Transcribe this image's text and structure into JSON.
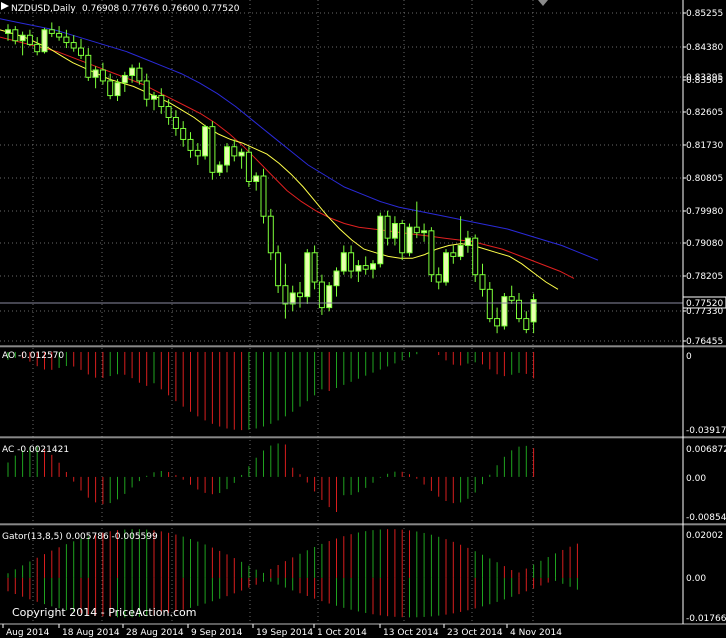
{
  "chart_data": {
    "type": "candlestick",
    "symbol_header": "NZDUSD,Daily",
    "ohlc_header": "0.76908 0.77676 0.76600 0.77520",
    "current_price_label": "0.77520",
    "copyright": "Copyright 2014 - PriceAction.com",
    "colors": {
      "background": "#000000",
      "grid": "#6a6a6a",
      "bull_candle": "#e8ffb0",
      "bear_candle": "#000000",
      "candle_outline": "#7dff3a",
      "lips": "#ffff4a",
      "teeth": "#e02020",
      "jaw": "#2a2ad8",
      "hist_up": "#1fa31f",
      "hist_down": "#d81e1e",
      "price_line": "#8a8aa0"
    },
    "price_axis": {
      "min": 0.7625,
      "max": 0.8555,
      "ticks": [
        "0.85255",
        "0.84380",
        "0.83395",
        "0.83505",
        "0.82605",
        "0.81730",
        "0.80805",
        "0.79980",
        "0.79080",
        "0.78205",
        "0.77330",
        "0.76455"
      ]
    },
    "date_axis": [
      "Aug 2014",
      "18 Aug 2014",
      "28 Aug 2014",
      "9 Sep 2014",
      "19 Sep 2014",
      "1 Oct 2014",
      "13 Oct 2014",
      "23 Oct 2014",
      "4 Nov 2014"
    ],
    "candles": [
      [
        0.848,
        0.8505,
        0.846,
        0.849
      ],
      [
        0.849,
        0.85,
        0.845,
        0.846
      ],
      [
        0.846,
        0.8485,
        0.842,
        0.8475
      ],
      [
        0.8475,
        0.849,
        0.8445,
        0.845
      ],
      [
        0.845,
        0.847,
        0.842,
        0.843
      ],
      [
        0.843,
        0.8495,
        0.8425,
        0.849
      ],
      [
        0.849,
        0.851,
        0.847,
        0.848
      ],
      [
        0.848,
        0.85,
        0.846,
        0.847
      ],
      [
        0.847,
        0.849,
        0.844,
        0.8455
      ],
      [
        0.8455,
        0.8475,
        0.843,
        0.844
      ],
      [
        0.844,
        0.8465,
        0.841,
        0.842
      ],
      [
        0.842,
        0.844,
        0.835,
        0.836
      ],
      [
        0.836,
        0.839,
        0.833,
        0.838
      ],
      [
        0.838,
        0.84,
        0.834,
        0.835
      ],
      [
        0.835,
        0.837,
        0.83,
        0.831
      ],
      [
        0.831,
        0.8355,
        0.8295,
        0.8345
      ],
      [
        0.8345,
        0.8375,
        0.832,
        0.8365
      ],
      [
        0.8365,
        0.8395,
        0.8345,
        0.8385
      ],
      [
        0.8385,
        0.84,
        0.834,
        0.835
      ],
      [
        0.835,
        0.837,
        0.828,
        0.83
      ],
      [
        0.83,
        0.832,
        0.827,
        0.831
      ],
      [
        0.831,
        0.833,
        0.826,
        0.828
      ],
      [
        0.828,
        0.83,
        0.823,
        0.825
      ],
      [
        0.825,
        0.827,
        0.82,
        0.822
      ],
      [
        0.822,
        0.824,
        0.817,
        0.819
      ],
      [
        0.819,
        0.821,
        0.814,
        0.816
      ],
      [
        0.816,
        0.818,
        0.812,
        0.8145
      ],
      [
        0.8145,
        0.823,
        0.8135,
        0.8225
      ],
      [
        0.8225,
        0.824,
        0.808,
        0.81
      ],
      [
        0.81,
        0.813,
        0.809,
        0.812
      ],
      [
        0.812,
        0.818,
        0.81,
        0.817
      ],
      [
        0.817,
        0.819,
        0.813,
        0.8145
      ],
      [
        0.8145,
        0.8165,
        0.811,
        0.8155
      ],
      [
        0.8155,
        0.817,
        0.806,
        0.8075
      ],
      [
        0.8075,
        0.81,
        0.805,
        0.809
      ],
      [
        0.809,
        0.811,
        0.796,
        0.798
      ],
      [
        0.798,
        0.8,
        0.786,
        0.788
      ],
      [
        0.788,
        0.79,
        0.777,
        0.779
      ],
      [
        0.779,
        0.785,
        0.77,
        0.774
      ],
      [
        0.774,
        0.779,
        0.772,
        0.777
      ],
      [
        0.777,
        0.78,
        0.773,
        0.776
      ],
      [
        0.776,
        0.789,
        0.774,
        0.788
      ],
      [
        0.788,
        0.79,
        0.778,
        0.78
      ],
      [
        0.78,
        0.782,
        0.771,
        0.773
      ],
      [
        0.773,
        0.78,
        0.772,
        0.779
      ],
      [
        0.779,
        0.784,
        0.776,
        0.783
      ],
      [
        0.783,
        0.79,
        0.782,
        0.788
      ],
      [
        0.788,
        0.79,
        0.781,
        0.783
      ],
      [
        0.783,
        0.786,
        0.78,
        0.7845
      ],
      [
        0.7845,
        0.787,
        0.782,
        0.7835
      ],
      [
        0.7835,
        0.786,
        0.781,
        0.785
      ],
      [
        0.785,
        0.799,
        0.784,
        0.798
      ],
      [
        0.798,
        0.7995,
        0.79,
        0.792
      ],
      [
        0.792,
        0.798,
        0.79,
        0.796
      ],
      [
        0.796,
        0.797,
        0.786,
        0.788
      ],
      [
        0.788,
        0.796,
        0.787,
        0.795
      ],
      [
        0.795,
        0.802,
        0.792,
        0.7935
      ],
      [
        0.7935,
        0.796,
        0.791,
        0.794
      ],
      [
        0.794,
        0.795,
        0.78,
        0.782
      ],
      [
        0.782,
        0.784,
        0.778,
        0.78
      ],
      [
        0.78,
        0.789,
        0.779,
        0.788
      ],
      [
        0.788,
        0.79,
        0.785,
        0.787
      ],
      [
        0.787,
        0.798,
        0.786,
        0.79
      ],
      [
        0.79,
        0.794,
        0.788,
        0.792
      ],
      [
        0.792,
        0.793,
        0.78,
        0.782
      ],
      [
        0.782,
        0.785,
        0.776,
        0.778
      ],
      [
        0.778,
        0.78,
        0.769,
        0.77
      ],
      [
        0.77,
        0.773,
        0.766,
        0.768
      ],
      [
        0.768,
        0.777,
        0.767,
        0.776
      ],
      [
        0.776,
        0.779,
        0.774,
        0.775
      ],
      [
        0.775,
        0.777,
        0.769,
        0.77
      ],
      [
        0.77,
        0.772,
        0.766,
        0.767
      ],
      [
        0.7691,
        0.7768,
        0.766,
        0.7752
      ]
    ],
    "alligator": {
      "lips": [
        0.849,
        0.848,
        0.847,
        0.8455,
        0.844,
        0.842,
        0.84,
        0.8385,
        0.837,
        0.8355,
        0.8345,
        0.8335,
        0.832,
        0.8305,
        0.829,
        0.827,
        0.825,
        0.8225,
        0.8205,
        0.819,
        0.818,
        0.8165,
        0.815,
        0.8125,
        0.8095,
        0.806,
        0.802,
        0.798,
        0.7945,
        0.7915,
        0.789,
        0.788,
        0.787,
        0.7865,
        0.7865,
        0.7875,
        0.789,
        0.79,
        0.7905,
        0.79,
        0.789,
        0.788,
        0.787,
        0.785,
        0.7825,
        0.78,
        0.778
      ],
      "lips_start": 26,
      "teeth": [
        0.847,
        0.846,
        0.845,
        0.844,
        0.843,
        0.8415,
        0.84,
        0.8385,
        0.837,
        0.8355,
        0.834,
        0.832,
        0.83,
        0.828,
        0.826,
        0.8235,
        0.8205,
        0.817,
        0.813,
        0.809,
        0.805,
        0.802,
        0.7995,
        0.7975,
        0.796,
        0.795,
        0.7945,
        0.794,
        0.7935,
        0.793,
        0.7925,
        0.792,
        0.7915,
        0.791,
        0.79,
        0.789,
        0.7875,
        0.786,
        0.7845,
        0.783,
        0.781
      ],
      "teeth_start": 34,
      "jaw": [
        0.852,
        0.851,
        0.85,
        0.849,
        0.8475,
        0.846,
        0.8445,
        0.843,
        0.841,
        0.839,
        0.837,
        0.8345,
        0.8315,
        0.828,
        0.824,
        0.82,
        0.816,
        0.812,
        0.809,
        0.806,
        0.804,
        0.802,
        0.8005,
        0.7995,
        0.7985,
        0.7975,
        0.7965,
        0.7955,
        0.7945,
        0.793,
        0.7915,
        0.79,
        0.788,
        0.786
      ],
      "jaw_start": 46
    },
    "ao": {
      "label": "AO -0.012570",
      "scale_top": "0",
      "scale_bottom": "-0.039171",
      "min": -0.042,
      "max": 0.001
    },
    "ac": {
      "label": "AC -0.0021421",
      "scale_top": "0.006872",
      "scale_mid": "0.00",
      "scale_bottom": "-0.008548",
      "min": -0.0092,
      "max": 0.0075
    },
    "gator": {
      "label": "Gator(13,8,5) 0.005786 -0.005599",
      "scale_top": "0.02002",
      "scale_mid": "0.00",
      "scale_bottom": "-0.01766",
      "min": -0.019,
      "max": 0.0215
    }
  }
}
